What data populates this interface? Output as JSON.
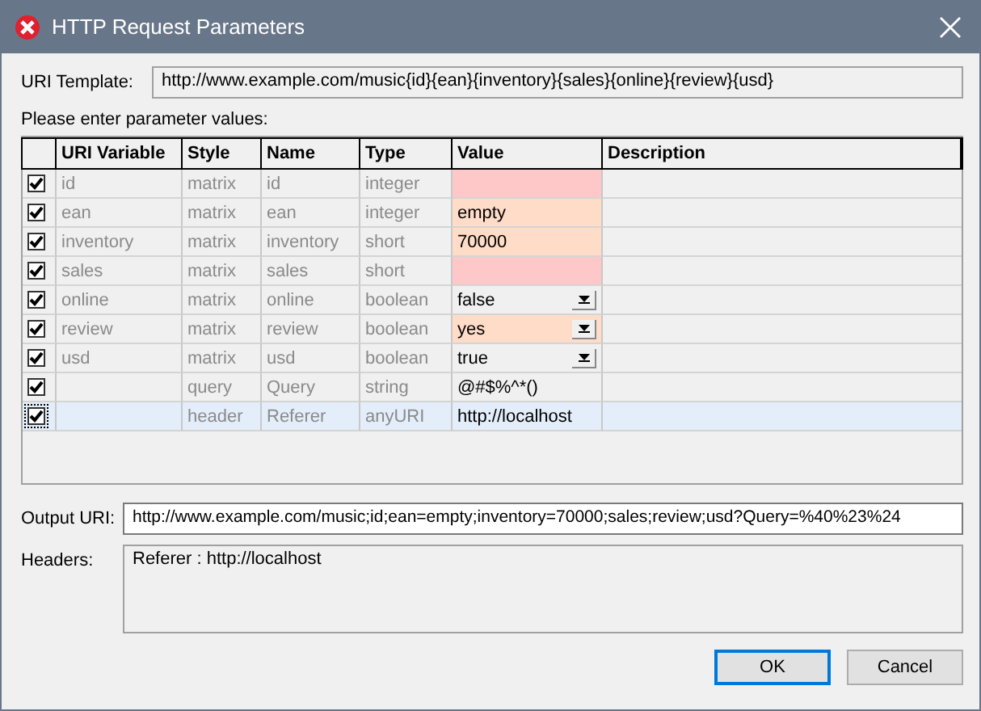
{
  "window": {
    "title": "HTTP Request Parameters"
  },
  "uri_template": {
    "label": "URI Template:",
    "value": "http://www.example.com/music{id}{ean}{inventory}{sales}{online}{review}{usd}"
  },
  "prompt": "Please enter parameter values:",
  "table": {
    "columns": [
      "URI Variable",
      "Style",
      "Name",
      "Type",
      "Value",
      "Description"
    ],
    "rows": [
      {
        "checked": true,
        "selected": false,
        "uri_variable": "id",
        "style": "matrix",
        "name": "id",
        "type": "integer",
        "kind": "text",
        "color": "#ffc8c8"
      },
      {
        "checked": true,
        "selected": false,
        "uri_variable": "ean",
        "style": "matrix",
        "name": "ean",
        "type": "integer",
        "value": "empty",
        "kind": "text",
        "color": "#ffdcc8"
      },
      {
        "checked": true,
        "selected": false,
        "uri_variable": "inventory",
        "style": "matrix",
        "name": "inventory",
        "type": "short",
        "value": "70000",
        "kind": "text",
        "color": "#ffdcc8"
      },
      {
        "checked": true,
        "selected": false,
        "uri_variable": "sales",
        "style": "matrix",
        "name": "sales",
        "type": "short",
        "kind": "text",
        "color": "#ffc8c8"
      },
      {
        "checked": true,
        "selected": false,
        "uri_variable": "online",
        "style": "matrix",
        "name": "online",
        "type": "boolean",
        "value": "false",
        "kind": "dropdown"
      },
      {
        "checked": true,
        "selected": false,
        "uri_variable": "review",
        "style": "matrix",
        "name": "review",
        "type": "boolean",
        "value": "yes",
        "kind": "dropdown",
        "color": "#ffdcc8"
      },
      {
        "checked": true,
        "selected": false,
        "uri_variable": "usd",
        "style": "matrix",
        "name": "usd",
        "type": "boolean",
        "value": "true",
        "kind": "dropdown"
      },
      {
        "checked": true,
        "selected": false,
        "style": "query",
        "name": "Query",
        "type": "string",
        "value": "@#$%^*()",
        "kind": "text"
      },
      {
        "checked": true,
        "selected": true,
        "style": "header",
        "name": "Referer",
        "type": "anyURI",
        "value": "http://localhost",
        "kind": "text"
      }
    ]
  },
  "output_uri": {
    "label": "Output URI:",
    "value": "http://www.example.com/music;id;ean=empty;inventory=70000;sales;review;usd?Query=%40%23%24"
  },
  "headers": {
    "label": "Headers:",
    "value": "Referer : http://localhost"
  },
  "buttons": [
    {
      "label": "OK",
      "default": true
    },
    {
      "label": "Cancel",
      "default": false
    }
  ]
}
